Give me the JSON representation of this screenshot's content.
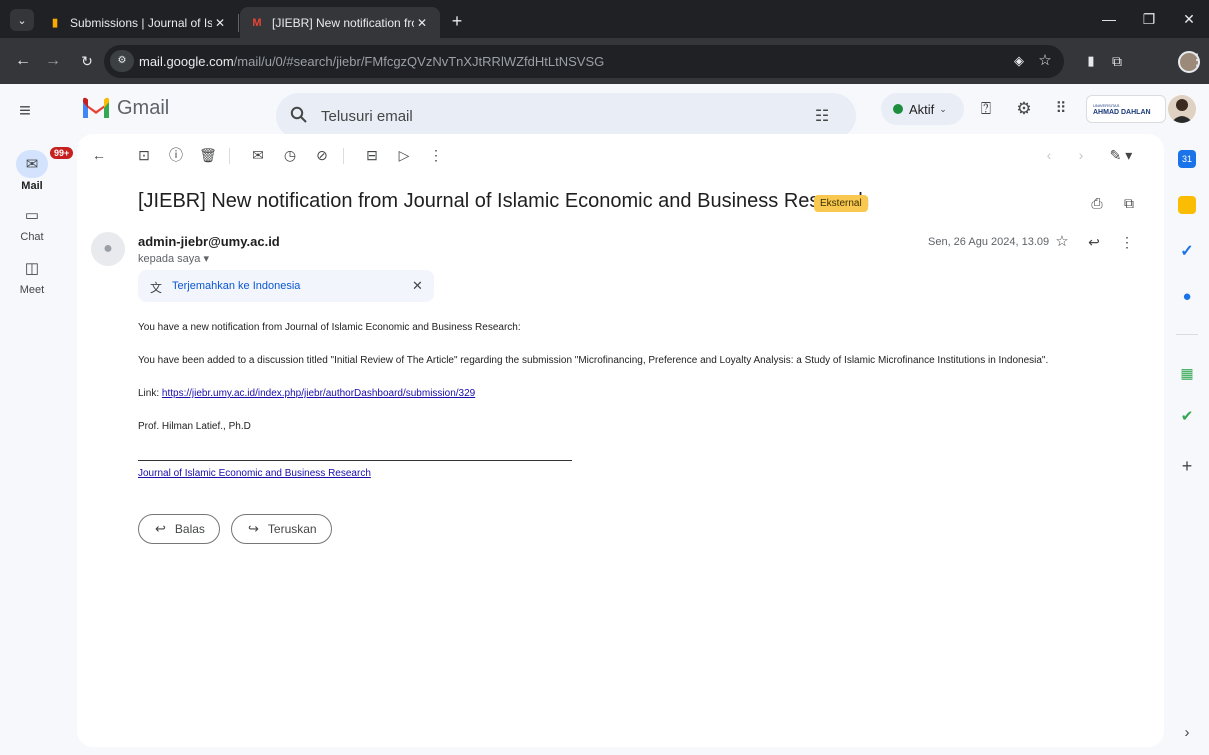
{
  "browser": {
    "tabs": [
      {
        "title": "Submissions | Journal of Islamic",
        "active": false
      },
      {
        "title": "[JIEBR] New notification from Jo",
        "active": true
      }
    ],
    "url_host": "mail.google.com",
    "url_path": "/mail/u/0/#search/jiebr/FMfcgzQVzNvTnXJtRRlWZfdHtLtNSVSG"
  },
  "gmail": {
    "logo_text": "Gmail",
    "search_placeholder": "Telusuri email",
    "status_label": "Aktif",
    "org_badge_top": "UNIVERSITAS",
    "org_badge_name": "AHMAD DAHLAN",
    "rail": [
      {
        "label": "Mail",
        "badge": "99+",
        "icon": "mail-icon"
      },
      {
        "label": "Chat",
        "icon": "chat-icon"
      },
      {
        "label": "Meet",
        "icon": "meet-icon"
      }
    ]
  },
  "email": {
    "subject": "[JIEBR] New notification from Journal of Islamic Economic and Business Research",
    "external_label": "Eksternal",
    "sender": "admin-jiebr@umy.ac.id",
    "to_me": "kepada saya",
    "date": "Sen, 26 Agu 2024, 13.09",
    "translate_label": "Terjemahkan ke Indonesia",
    "body": {
      "line1": "You have a new notification from Journal of Islamic Economic and Business Research:",
      "line2": "You have been added to a discussion titled \"Initial Review of The Article\" regarding the submission \"Microfinancing, Preference and Loyalty Analysis: a Study of Islamic Microfinance Institutions in Indonesia\".",
      "link_prefix": "Link: ",
      "link_url": "https://jiebr.umy.ac.id/index.php/jiebr/authorDashboard/submission/329",
      "signer": "Prof. Hilman Latief., Ph.D",
      "journal_link": "Journal of Islamic Economic and Business Research"
    },
    "reply_label": "Balas",
    "forward_label": "Teruskan"
  },
  "colors": {
    "accent": "#0b57d0",
    "external_chip": "#f9c851",
    "badge_red": "#c5221f",
    "status_green": "#1e8e3e"
  }
}
